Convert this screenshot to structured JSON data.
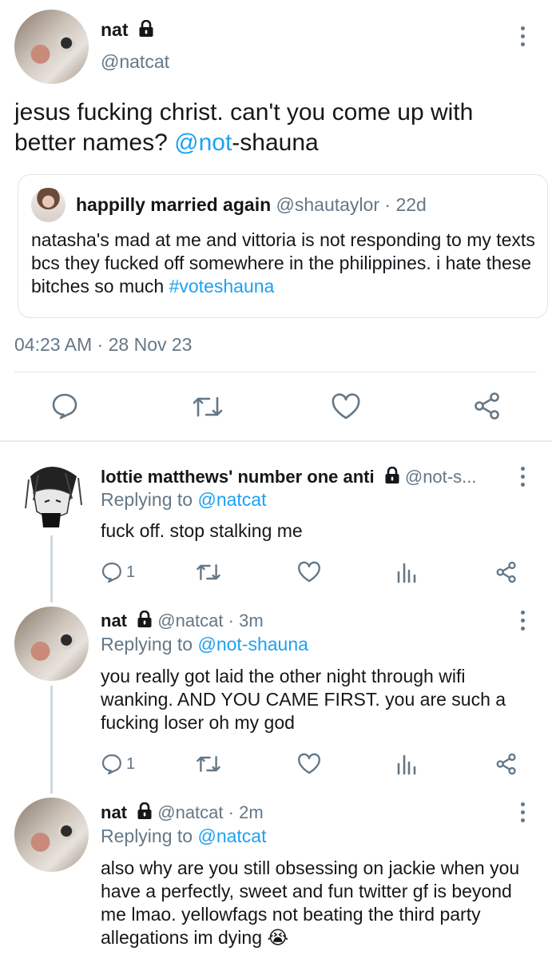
{
  "main_tweet": {
    "display_name": "nat",
    "handle": "@natcat",
    "text_prefix": "jesus fucking christ. can't you come up with better names? ",
    "mention_link": "@not",
    "mention_rest": "-shauna",
    "timestamp": "04:23 AM · 28 Nov 23"
  },
  "quoted_tweet": {
    "display_name": "happilly married again",
    "handle": "@shautaylor",
    "time": "· 22d",
    "text": "natasha's mad at me and vittoria is not responding to my texts bcs they fucked off somewhere in the philippines. i hate these bitches so much ",
    "hashtag": "#voteshauna"
  },
  "replies": [
    {
      "display_name": "lottie matthews' number one anti",
      "handle": "@not-s...",
      "time": "",
      "replying_label": "Replying to",
      "replying_to": "@natcat",
      "text": "fuck off. stop stalking me",
      "reply_count": "1"
    },
    {
      "display_name": "nat",
      "handle": "@natcat",
      "time": "· 3m",
      "replying_label": "Replying to",
      "replying_to": "@not-shauna",
      "text": "you really got laid the other night through wifi wanking. AND YOU CAME FIRST. you are such a fucking loser oh my god",
      "reply_count": "1"
    },
    {
      "display_name": "nat",
      "handle": "@natcat",
      "time": "· 2m",
      "replying_label": "Replying to",
      "replying_to": "@natcat",
      "text": "also why are you still obsessing on jackie when you have a perfectly, sweet and fun twitter gf is beyond me lmao. yellowfags not beating the third party allegations im dying ",
      "emoji": "😭"
    }
  ],
  "colors": {
    "accent": "#1da1f2",
    "secondary_text": "#657786",
    "divider": "#e1e8ed"
  },
  "icons": [
    "lock-icon",
    "more-icon",
    "reply-icon",
    "retweet-icon",
    "like-icon",
    "share-icon",
    "analytics-icon"
  ]
}
